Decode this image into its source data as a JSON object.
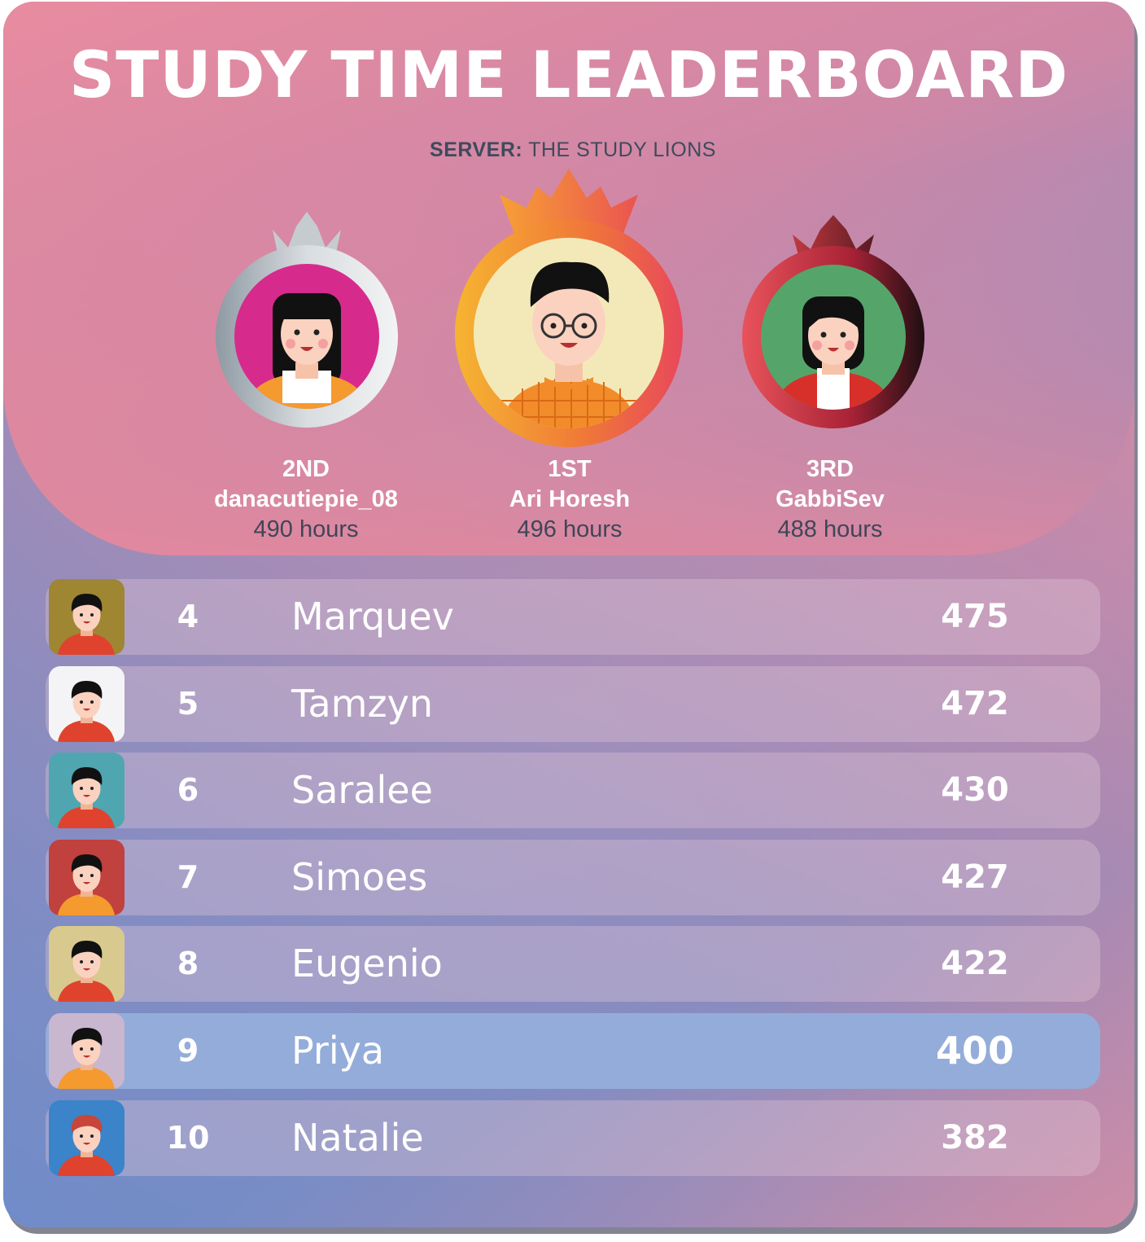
{
  "title": "STUDY TIME LEADERBOARD",
  "server": {
    "label": "SERVER:",
    "name": "THE STUDY LIONS"
  },
  "podium": [
    {
      "place": "1ST",
      "name": "Ari Horesh",
      "hours": "496 hours",
      "ring": "gold",
      "avatar_bg": "#f3e9b8",
      "icon": "boy-glasses-avatar"
    },
    {
      "place": "2ND",
      "name": "danacutiepie_08",
      "hours": "490 hours",
      "ring": "silver",
      "avatar_bg": "#d62b8c",
      "icon": "girl-bangs-avatar"
    },
    {
      "place": "3RD",
      "name": "GabbiSev",
      "hours": "488 hours",
      "ring": "bronze",
      "avatar_bg": "#55a56b",
      "icon": "girl-bob-avatar"
    }
  ],
  "leaderboard": [
    {
      "rank": "4",
      "name": "Marquev",
      "score": "475",
      "avatar_bg": "#9e8633",
      "shirt": "#e0432d",
      "hair": "#111111"
    },
    {
      "rank": "5",
      "name": "Tamzyn",
      "score": "472",
      "avatar_bg": "#f4f4f6",
      "shirt": "#e0432d",
      "hair": "#111111"
    },
    {
      "rank": "6",
      "name": "Saralee",
      "score": "430",
      "avatar_bg": "#4fa6b0",
      "shirt": "#e0432d",
      "hair": "#111111"
    },
    {
      "rank": "7",
      "name": "Simoes",
      "score": "427",
      "avatar_bg": "#c0413d",
      "shirt": "#f59a2e",
      "hair": "#111111"
    },
    {
      "rank": "8",
      "name": "Eugenio",
      "score": "422",
      "avatar_bg": "#d8c98f",
      "shirt": "#e0432d",
      "hair": "#111111"
    },
    {
      "rank": "9",
      "name": "Priya",
      "score": "400",
      "avatar_bg": "#c9b6cf",
      "shirt": "#f59a2e",
      "hair": "#111111",
      "highlight": true
    },
    {
      "rank": "10",
      "name": "Natalie",
      "score": "382",
      "avatar_bg": "#3b84c9",
      "shirt": "#e0432d",
      "hair": "#c8453a"
    }
  ],
  "colors": {
    "gold": "#f0a23a",
    "silver": "#b9bec4",
    "bronze": "#c2393f",
    "highlight_row": "#94acd9"
  }
}
